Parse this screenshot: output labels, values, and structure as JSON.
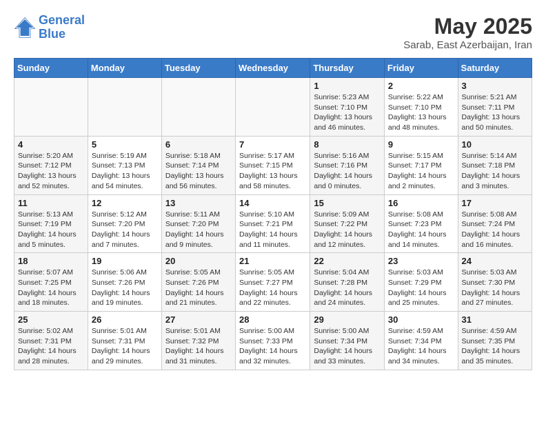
{
  "header": {
    "logo_line1": "General",
    "logo_line2": "Blue",
    "month": "May 2025",
    "location": "Sarab, East Azerbaijan, Iran"
  },
  "days_of_week": [
    "Sunday",
    "Monday",
    "Tuesday",
    "Wednesday",
    "Thursday",
    "Friday",
    "Saturday"
  ],
  "weeks": [
    [
      {
        "day": "",
        "info": ""
      },
      {
        "day": "",
        "info": ""
      },
      {
        "day": "",
        "info": ""
      },
      {
        "day": "",
        "info": ""
      },
      {
        "day": "1",
        "info": "Sunrise: 5:23 AM\nSunset: 7:10 PM\nDaylight: 13 hours\nand 46 minutes."
      },
      {
        "day": "2",
        "info": "Sunrise: 5:22 AM\nSunset: 7:10 PM\nDaylight: 13 hours\nand 48 minutes."
      },
      {
        "day": "3",
        "info": "Sunrise: 5:21 AM\nSunset: 7:11 PM\nDaylight: 13 hours\nand 50 minutes."
      }
    ],
    [
      {
        "day": "4",
        "info": "Sunrise: 5:20 AM\nSunset: 7:12 PM\nDaylight: 13 hours\nand 52 minutes."
      },
      {
        "day": "5",
        "info": "Sunrise: 5:19 AM\nSunset: 7:13 PM\nDaylight: 13 hours\nand 54 minutes."
      },
      {
        "day": "6",
        "info": "Sunrise: 5:18 AM\nSunset: 7:14 PM\nDaylight: 13 hours\nand 56 minutes."
      },
      {
        "day": "7",
        "info": "Sunrise: 5:17 AM\nSunset: 7:15 PM\nDaylight: 13 hours\nand 58 minutes."
      },
      {
        "day": "8",
        "info": "Sunrise: 5:16 AM\nSunset: 7:16 PM\nDaylight: 14 hours\nand 0 minutes."
      },
      {
        "day": "9",
        "info": "Sunrise: 5:15 AM\nSunset: 7:17 PM\nDaylight: 14 hours\nand 2 minutes."
      },
      {
        "day": "10",
        "info": "Sunrise: 5:14 AM\nSunset: 7:18 PM\nDaylight: 14 hours\nand 3 minutes."
      }
    ],
    [
      {
        "day": "11",
        "info": "Sunrise: 5:13 AM\nSunset: 7:19 PM\nDaylight: 14 hours\nand 5 minutes."
      },
      {
        "day": "12",
        "info": "Sunrise: 5:12 AM\nSunset: 7:20 PM\nDaylight: 14 hours\nand 7 minutes."
      },
      {
        "day": "13",
        "info": "Sunrise: 5:11 AM\nSunset: 7:20 PM\nDaylight: 14 hours\nand 9 minutes."
      },
      {
        "day": "14",
        "info": "Sunrise: 5:10 AM\nSunset: 7:21 PM\nDaylight: 14 hours\nand 11 minutes."
      },
      {
        "day": "15",
        "info": "Sunrise: 5:09 AM\nSunset: 7:22 PM\nDaylight: 14 hours\nand 12 minutes."
      },
      {
        "day": "16",
        "info": "Sunrise: 5:08 AM\nSunset: 7:23 PM\nDaylight: 14 hours\nand 14 minutes."
      },
      {
        "day": "17",
        "info": "Sunrise: 5:08 AM\nSunset: 7:24 PM\nDaylight: 14 hours\nand 16 minutes."
      }
    ],
    [
      {
        "day": "18",
        "info": "Sunrise: 5:07 AM\nSunset: 7:25 PM\nDaylight: 14 hours\nand 18 minutes."
      },
      {
        "day": "19",
        "info": "Sunrise: 5:06 AM\nSunset: 7:26 PM\nDaylight: 14 hours\nand 19 minutes."
      },
      {
        "day": "20",
        "info": "Sunrise: 5:05 AM\nSunset: 7:26 PM\nDaylight: 14 hours\nand 21 minutes."
      },
      {
        "day": "21",
        "info": "Sunrise: 5:05 AM\nSunset: 7:27 PM\nDaylight: 14 hours\nand 22 minutes."
      },
      {
        "day": "22",
        "info": "Sunrise: 5:04 AM\nSunset: 7:28 PM\nDaylight: 14 hours\nand 24 minutes."
      },
      {
        "day": "23",
        "info": "Sunrise: 5:03 AM\nSunset: 7:29 PM\nDaylight: 14 hours\nand 25 minutes."
      },
      {
        "day": "24",
        "info": "Sunrise: 5:03 AM\nSunset: 7:30 PM\nDaylight: 14 hours\nand 27 minutes."
      }
    ],
    [
      {
        "day": "25",
        "info": "Sunrise: 5:02 AM\nSunset: 7:31 PM\nDaylight: 14 hours\nand 28 minutes."
      },
      {
        "day": "26",
        "info": "Sunrise: 5:01 AM\nSunset: 7:31 PM\nDaylight: 14 hours\nand 29 minutes."
      },
      {
        "day": "27",
        "info": "Sunrise: 5:01 AM\nSunset: 7:32 PM\nDaylight: 14 hours\nand 31 minutes."
      },
      {
        "day": "28",
        "info": "Sunrise: 5:00 AM\nSunset: 7:33 PM\nDaylight: 14 hours\nand 32 minutes."
      },
      {
        "day": "29",
        "info": "Sunrise: 5:00 AM\nSunset: 7:34 PM\nDaylight: 14 hours\nand 33 minutes."
      },
      {
        "day": "30",
        "info": "Sunrise: 4:59 AM\nSunset: 7:34 PM\nDaylight: 14 hours\nand 34 minutes."
      },
      {
        "day": "31",
        "info": "Sunrise: 4:59 AM\nSunset: 7:35 PM\nDaylight: 14 hours\nand 35 minutes."
      }
    ]
  ]
}
